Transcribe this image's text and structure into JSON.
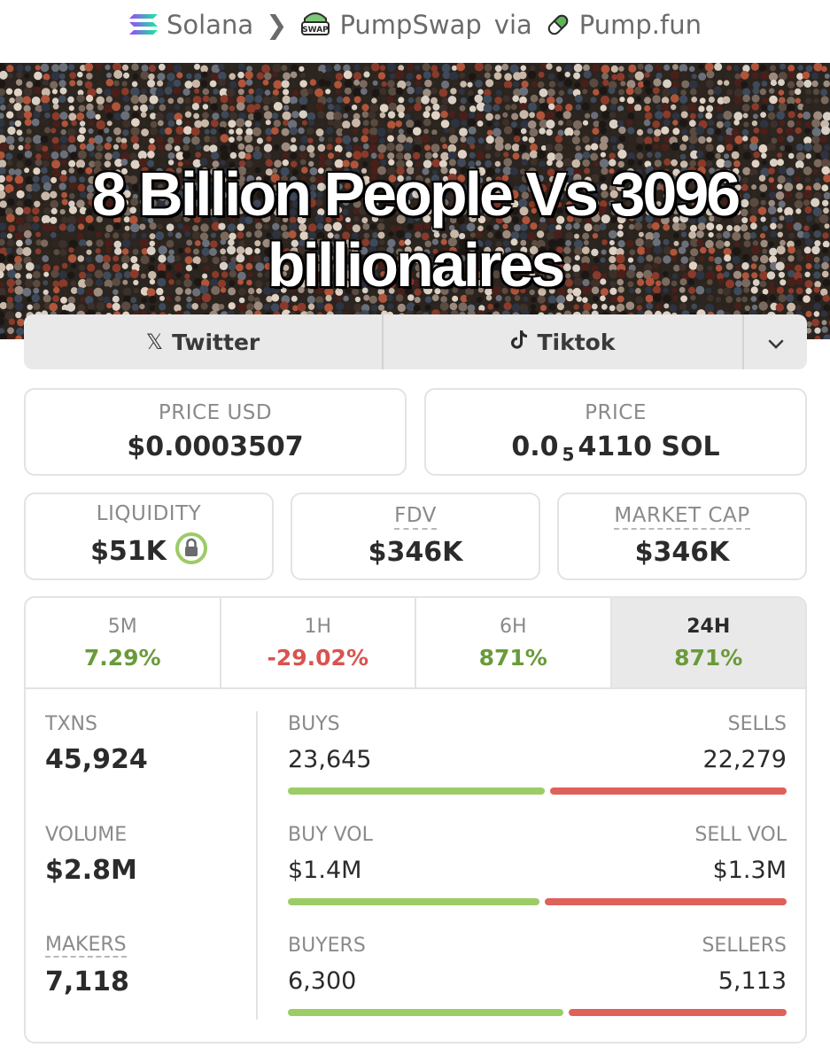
{
  "breadcrumb": {
    "chain": "Solana",
    "dex": "PumpSwap",
    "dex_badge": "SWAP",
    "via": "via",
    "launchpad": "Pump.fun"
  },
  "banner": {
    "headline": "8 Billion People Vs 3096 billionaires"
  },
  "social": {
    "twitter": "Twitter",
    "tiktok": "Tiktok"
  },
  "price_usd": {
    "label": "PRICE USD",
    "value": "$0.0003507"
  },
  "price_native": {
    "label": "PRICE",
    "prefix": "0.0",
    "zeros": "5",
    "digits": "4110 SOL"
  },
  "liquidity": {
    "label": "LIQUIDITY",
    "value": "$51K"
  },
  "fdv": {
    "label": "FDV",
    "value": "$346K"
  },
  "market_cap": {
    "label": "MARKET CAP",
    "value": "$346K"
  },
  "timeframes": [
    {
      "label": "5M",
      "change": "7.29%",
      "color": "#6a9a3a"
    },
    {
      "label": "1H",
      "change": "-29.02%",
      "color": "#d9534f"
    },
    {
      "label": "6H",
      "change": "871%",
      "color": "#6a9a3a"
    },
    {
      "label": "24H",
      "change": "871%",
      "color": "#6a9a3a",
      "active": true
    }
  ],
  "stats": {
    "txns": {
      "label": "TXNS",
      "value": "45,924"
    },
    "volume": {
      "label": "VOLUME",
      "value": "$2.8M"
    },
    "makers": {
      "label": "MAKERS",
      "value": "7,118"
    }
  },
  "splits": {
    "txns": {
      "left_label": "BUYS",
      "left_value": "23,645",
      "right_label": "SELLS",
      "right_value": "22,279",
      "buy_share": 0.515
    },
    "volume": {
      "left_label": "BUY VOL",
      "left_value": "$1.4M",
      "right_label": "SELL VOL",
      "right_value": "$1.3M",
      "buy_share": 0.505
    },
    "makers": {
      "left_label": "BUYERS",
      "left_value": "6,300",
      "right_label": "SELLERS",
      "right_value": "5,113",
      "buy_share": 0.552
    }
  },
  "colors": {
    "buy": "#9ccc65",
    "sell": "#e0605a",
    "positive": "#6a9a3a",
    "negative": "#d9534f"
  }
}
